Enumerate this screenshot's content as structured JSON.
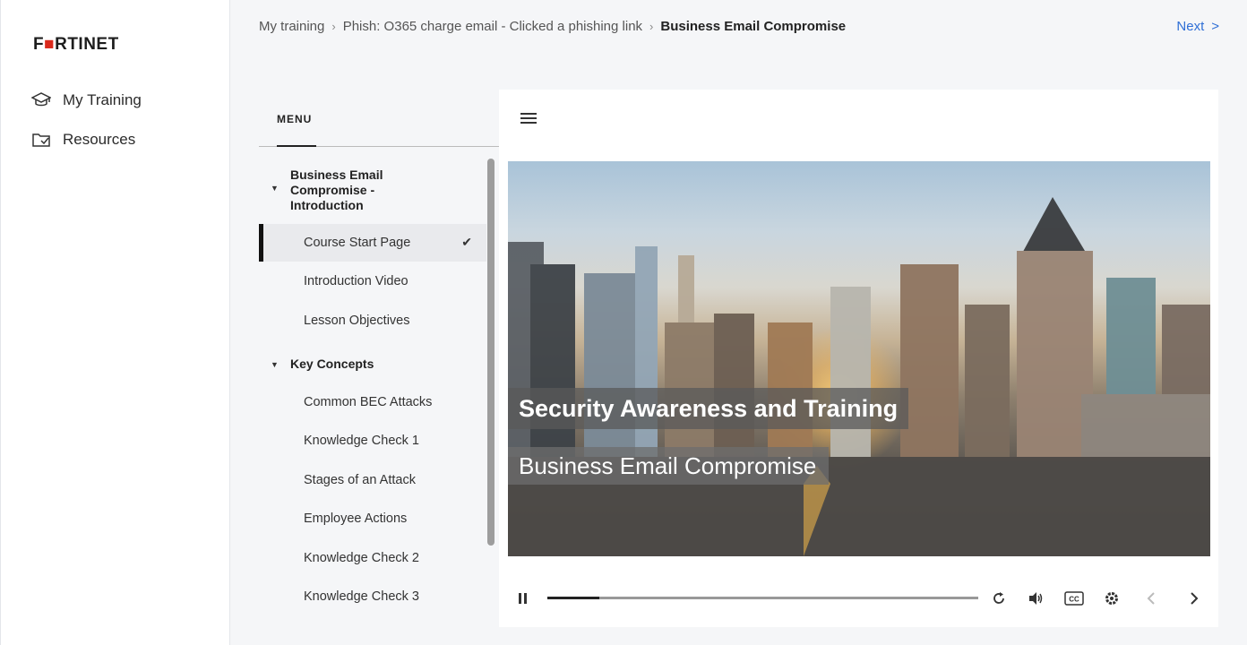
{
  "app": {
    "logo_text": "FORTINET"
  },
  "sidebar": {
    "items": [
      {
        "label": "My Training",
        "icon": "graduation-cap-icon"
      },
      {
        "label": "Resources",
        "icon": "folder-icon"
      }
    ]
  },
  "breadcrumb": {
    "items": [
      "My training",
      "Phish: O365 charge email - Clicked a phishing link"
    ],
    "current": "Business Email Compromise"
  },
  "next": {
    "label": "Next",
    "icon": "chevron-right-icon",
    "glyph": ">"
  },
  "menu": {
    "tab_label": "MENU",
    "sections": [
      {
        "title": "Business Email Compromise - Introduction",
        "title_lines": [
          "Business Email",
          "Compromise -",
          "Introduction"
        ],
        "lessons": [
          {
            "label": "Course Start Page",
            "active": true,
            "completed": true
          },
          {
            "label": "Introduction Video"
          },
          {
            "label": "Lesson Objectives"
          }
        ]
      },
      {
        "title": "Key Concepts",
        "lessons": [
          {
            "label": "Common BEC Attacks"
          },
          {
            "label": "Knowledge Check 1"
          },
          {
            "label": "Stages of an Attack"
          },
          {
            "label": "Employee Actions"
          },
          {
            "label": "Knowledge Check 2"
          },
          {
            "label": "Knowledge Check 3"
          }
        ]
      }
    ]
  },
  "slide": {
    "title": "Security Awareness and Training",
    "subtitle": "Business Email Compromise"
  },
  "player": {
    "progress": 0.12,
    "colors": {
      "accent": "#2f6fd6",
      "brand_red": "#da291c"
    }
  }
}
